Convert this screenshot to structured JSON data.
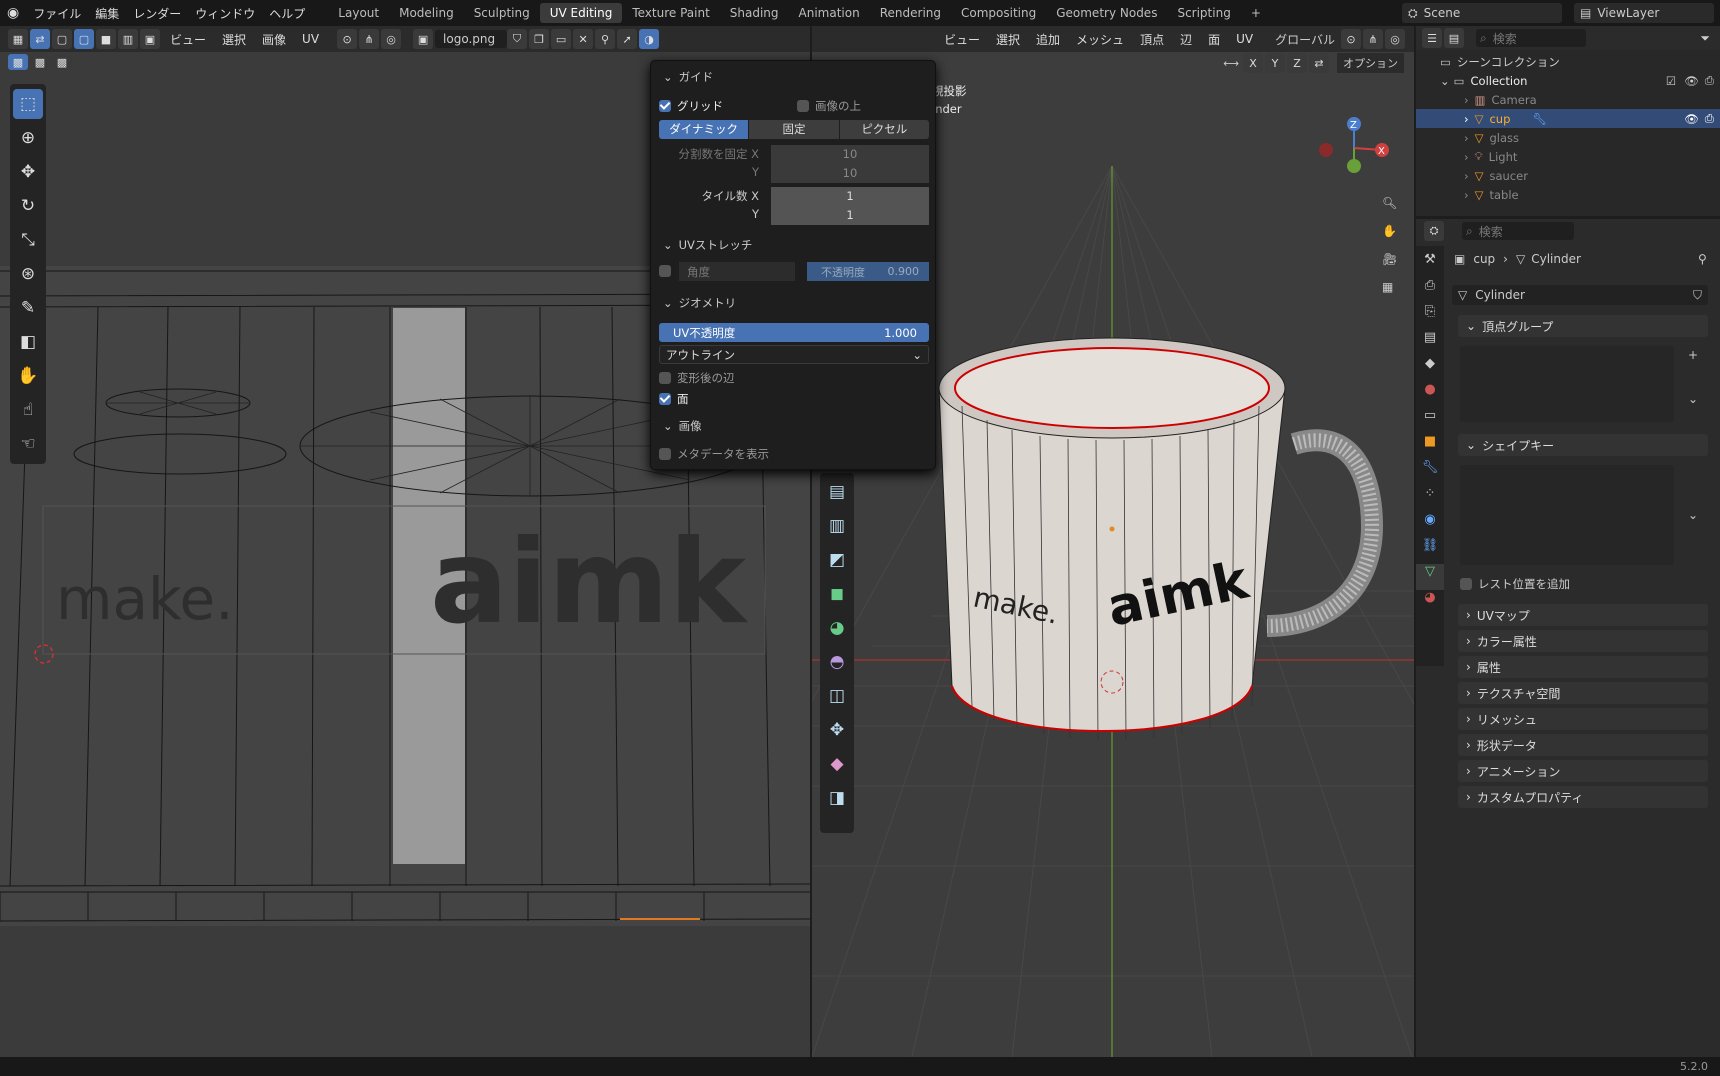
{
  "topmenu": [
    "ファイル",
    "編集",
    "レンダー",
    "ウィンドウ",
    "ヘルプ"
  ],
  "workspaces": [
    "Layout",
    "Modeling",
    "Sculpting",
    "UV Editing",
    "Texture Paint",
    "Shading",
    "Animation",
    "Rendering",
    "Compositing",
    "Geometry Nodes",
    "Scripting"
  ],
  "active_workspace": "UV Editing",
  "scene": "Scene",
  "viewlayer": "ViewLayer",
  "uv_header": {
    "menus": [
      "ビュー",
      "選択",
      "画像",
      "UV"
    ],
    "image_name": "logo.png"
  },
  "view3d_header": {
    "menus": [
      "ビュー",
      "選択",
      "追加",
      "メッシュ",
      "頂点",
      "辺",
      "面",
      "UV"
    ],
    "orientation": "グローバル",
    "options": "オプション",
    "axes": [
      "X",
      "Y",
      "Z"
    ]
  },
  "view3d_overlay": {
    "line1": "視投影",
    "line2": "inder"
  },
  "popup": {
    "guide_title": "ガイド",
    "grid": "グリッド",
    "over_image": "画像の上",
    "modes": [
      "ダイナミック",
      "固定",
      "ピクセル"
    ],
    "fixed_sub_x": "分割数を固定 X",
    "y": "Y",
    "fixed_x": "10",
    "fixed_y": "10",
    "tiles_x": "タイル数 X",
    "tiles_val_x": "1",
    "tiles_val_y": "1",
    "stretch_title": "UVストレッチ",
    "angle": "角度",
    "opacity_label": "不透明度",
    "opacity_val": "0.900",
    "geom_title": "ジオメトリ",
    "uv_opacity": "UV不透明度",
    "uv_opacity_val": "1.000",
    "outline": "アウトライン",
    "modified_edges": "変形後の辺",
    "faces": "面",
    "image_title": "画像",
    "show_meta": "メタデータを表示"
  },
  "outliner": {
    "search_placeholder": "検索",
    "root": "シーンコレクション",
    "collection": "Collection",
    "items": [
      {
        "name": "Camera"
      },
      {
        "name": "cup"
      },
      {
        "name": "glass"
      },
      {
        "name": "Light"
      },
      {
        "name": "saucer"
      },
      {
        "name": "table"
      }
    ]
  },
  "props": {
    "search_placeholder": "検索",
    "crumb_obj": "cup",
    "crumb_mesh": "Cylinder",
    "mesh_name": "Cylinder",
    "vertex_groups": "頂点グループ",
    "shape_keys": "シェイプキー",
    "rest_pos": "レスト位置を追加",
    "panels": [
      "UVマップ",
      "カラー属性",
      "属性",
      "テクスチャ空間",
      "リメッシュ",
      "形状データ",
      "アニメーション",
      "カスタムプロパティ"
    ]
  },
  "uv_texts": {
    "make": "make.",
    "aimk": "aimk"
  },
  "version": "5.2.0"
}
